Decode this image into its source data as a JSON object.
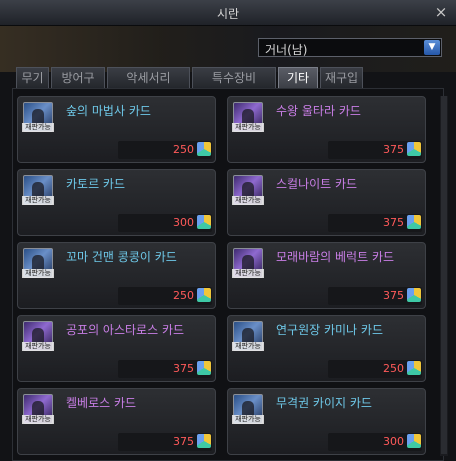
{
  "window": {
    "title": "시란",
    "close_label": "×"
  },
  "filter": {
    "selected": "거너(남)"
  },
  "tabs": [
    {
      "label": "무기",
      "active": false
    },
    {
      "label": "방어구",
      "active": false
    },
    {
      "label": "악세서리",
      "active": false
    },
    {
      "label": "특수장비",
      "active": false
    },
    {
      "label": "기타",
      "active": true
    },
    {
      "label": "재구입",
      "active": false
    }
  ],
  "items": [
    {
      "name": "숲의 마법사 카드",
      "price": "250",
      "badge": "재판가능",
      "rarity": "blue"
    },
    {
      "name": "수왕 울타라 카드",
      "price": "375",
      "badge": "재판가능",
      "rarity": "purple"
    },
    {
      "name": "카토르 카드",
      "price": "300",
      "badge": "재판가능",
      "rarity": "blue"
    },
    {
      "name": "스컬나이트 카드",
      "price": "375",
      "badge": "재판가능",
      "rarity": "purple"
    },
    {
      "name": "꼬마 건맨 콩콩이 카드",
      "price": "250",
      "badge": "재판가능",
      "rarity": "blue"
    },
    {
      "name": "모래바람의 베럭트 카드",
      "price": "375",
      "badge": "재판가능",
      "rarity": "purple"
    },
    {
      "name": "공포의 아스타로스 카드",
      "price": "375",
      "badge": "재판가능",
      "rarity": "purple"
    },
    {
      "name": "연구원장 카미나 카드",
      "price": "250",
      "badge": "재판가능",
      "rarity": "blue"
    },
    {
      "name": "켈베로스 카드",
      "price": "375",
      "badge": "재판가능",
      "rarity": "purple"
    },
    {
      "name": "무격권 카이지 카드",
      "price": "300",
      "badge": "재판가능",
      "rarity": "blue"
    }
  ],
  "currency_icon": "cube-currency-icon"
}
